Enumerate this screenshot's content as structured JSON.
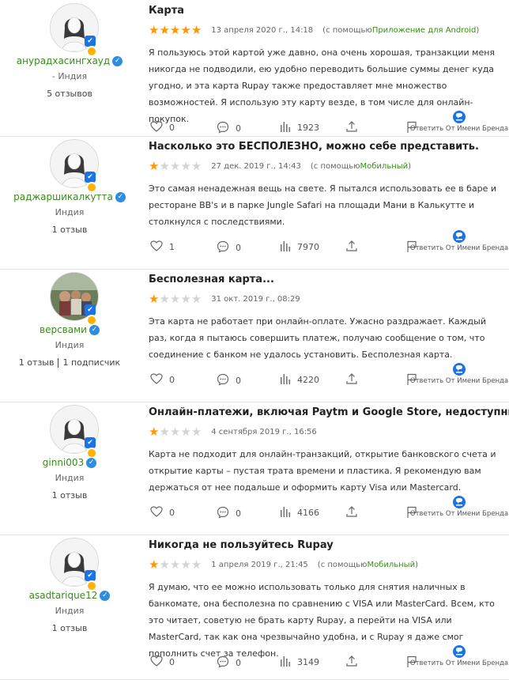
{
  "reviews": [
    {
      "user": {
        "name": "анурадхасингхауд",
        "country": "- Индия",
        "stats": [
          "5 отзывов"
        ]
      },
      "title": "Карта",
      "stars": 5,
      "date": "13 апреля 2020 г., 14:18",
      "via_prefix": "(с помощью",
      "via_source": "Приложение для Android",
      "via_suffix": ")",
      "text": "Я пользуюсь этой картой уже давно, она очень хорошая, транзакции меня никогда не подводили, ею удобно переводить большие суммы денег куда угодно, и эта карта Rupay также предоставляет мне множество возможностей. Я использую эту карту везде, в том числе для онлайн-покупок.",
      "likes": "0",
      "comments": "0",
      "views": "1923",
      "brand_reply": "Ответить От Имени Бренда"
    },
    {
      "user": {
        "name": "раджаршикалкутта",
        "country": "Индия",
        "stats": [
          "1 отзыв"
        ]
      },
      "title": "Насколько это БЕСПОЛЕЗНО, можно себе представить.",
      "stars": 1,
      "date": "27 дек. 2019 г., 14:43",
      "via_prefix": "(с помощью",
      "via_source": "Мобильный",
      "via_suffix": ")",
      "text": "Это самая ненадежная вещь на свете. Я пытался использовать ее в баре и ресторане BB's и в парке Jungle Safari на площади Мани в Калькутте и столкнулся с последствиями.",
      "likes": "1",
      "comments": "0",
      "views": "7970",
      "brand_reply": "Ответить От Имени Бренда"
    },
    {
      "user": {
        "name": "версвами",
        "country": "Индия",
        "stats": [
          "1 отзыв",
          "1 подписчик"
        ]
      },
      "title": "Бесполезная карта...",
      "stars": 1,
      "date": "31 окт. 2019 г., 08:29",
      "via_prefix": "",
      "via_source": "",
      "via_suffix": "",
      "text": "Эта карта не работает при онлайн-оплате. Ужасно раздражает. Каждый раз, когда я пытаюсь совершить платеж, получаю сообщение о том, что соединение с банком не удалось установить. Бесполезная карта.",
      "likes": "0",
      "comments": "0",
      "views": "4220",
      "brand_reply": "Ответить От Имени Бренда"
    },
    {
      "user": {
        "name": "ginni003",
        "country": "Индия",
        "stats": [
          "1 отзыв"
        ]
      },
      "title": "Онлайн-платежи, включая Paytm и Google Store, недоступны.",
      "stars": 1,
      "date": "4 сентября 2019 г., 16:56",
      "via_prefix": "",
      "via_source": "",
      "via_suffix": "",
      "text": "Карта не подходит для онлайн-транзакций, открытие банковского счета и открытие карты – пустая трата времени и пластика. Я рекомендую вам держаться от нее подальше и оформить карту Visa или Mastercard.",
      "likes": "0",
      "comments": "0",
      "views": "4166",
      "brand_reply": "Ответить От Имени Бренда"
    },
    {
      "user": {
        "name": "asadtarique12",
        "country": "Индия",
        "stats": [
          "1 отзыв"
        ]
      },
      "title": "Никогда не пользуйтесь Rupay",
      "stars": 1,
      "date": "1 апреля 2019 г., 21:45",
      "via_prefix": "(с помощью",
      "via_source": "Мобильный",
      "via_suffix": ")",
      "text": "Я думаю, что ее можно использовать только для снятия наличных в банкомате, она бесполезна по сравнению с VISA или MasterCard. Всем, кто это читает, советую не брать карту Rupay, а перейти на VISA или MasterCard, так как она чрезвычайно удобна, и с Rupay я даже смог пополнить счет за телефон.",
      "likes": "0",
      "comments": "0",
      "views": "3149",
      "brand_reply": "Ответить От Имени Бренда"
    }
  ],
  "colors": {
    "star_on": "#ff9800",
    "star_off": "#d4d4d4",
    "username": "#3a8a1c",
    "verified": "#2e8de0"
  },
  "icons": [
    "heart-icon",
    "comment-icon",
    "views-bar-icon",
    "share-icon",
    "flag-icon",
    "brand-reply-icon",
    "verified-check-icon",
    "shield-badge-icon"
  ]
}
